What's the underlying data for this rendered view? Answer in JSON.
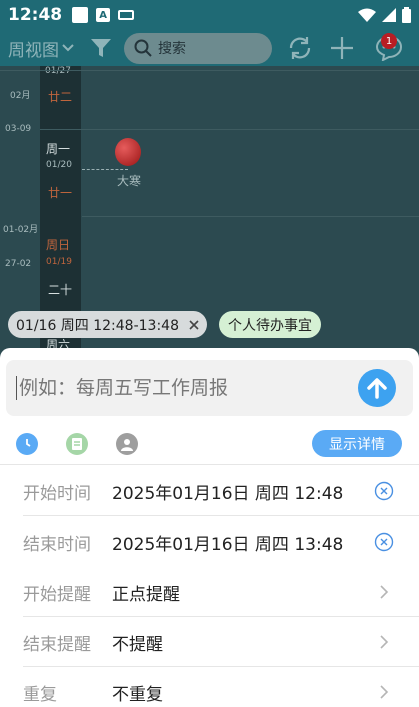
{
  "status": {
    "time": "12:48",
    "a_label": "A"
  },
  "toolbar": {
    "view_label": "周视图",
    "search_placeholder": "搜索",
    "badge_count": "1"
  },
  "calendar": {
    "month_top": "01/27",
    "rows": [
      {
        "lunar": "廿二",
        "left": "02月"
      },
      {
        "left": "03-09"
      },
      {
        "weekday": "周一",
        "date": "01/20",
        "lunar": "廿一"
      },
      {
        "event": "大寒"
      },
      {
        "left": "01-02月"
      },
      {
        "weekday": "周日",
        "date": "01/19",
        "lunar": "二十",
        "left": "27-02"
      },
      {
        "weekday": "周六"
      }
    ]
  },
  "chips": {
    "time_range": "01/16 周四 12:48-13:48",
    "category": "个人待办事宜"
  },
  "sheet": {
    "input_placeholder": "例如：每周五写工作周报",
    "detail_button": "显示详情",
    "rows": [
      {
        "key": "开始时间",
        "value": "2025年01月16日 周四 12:48",
        "action": "clear"
      },
      {
        "key": "结束时间",
        "value": "2025年01月16日 周四 13:48",
        "action": "clear"
      },
      {
        "key": "开始提醒",
        "value": "正点提醒",
        "action": "chevron"
      },
      {
        "key": "结束提醒",
        "value": "不提醒",
        "action": "chevron"
      },
      {
        "key": "重复",
        "value": "不重复",
        "action": "chevron"
      }
    ]
  },
  "colors": {
    "accent": "#3da2f0",
    "toolbar": "#1f6a75",
    "detail_button": "#5aaaf5",
    "green_chip": "#d5f0d4"
  }
}
